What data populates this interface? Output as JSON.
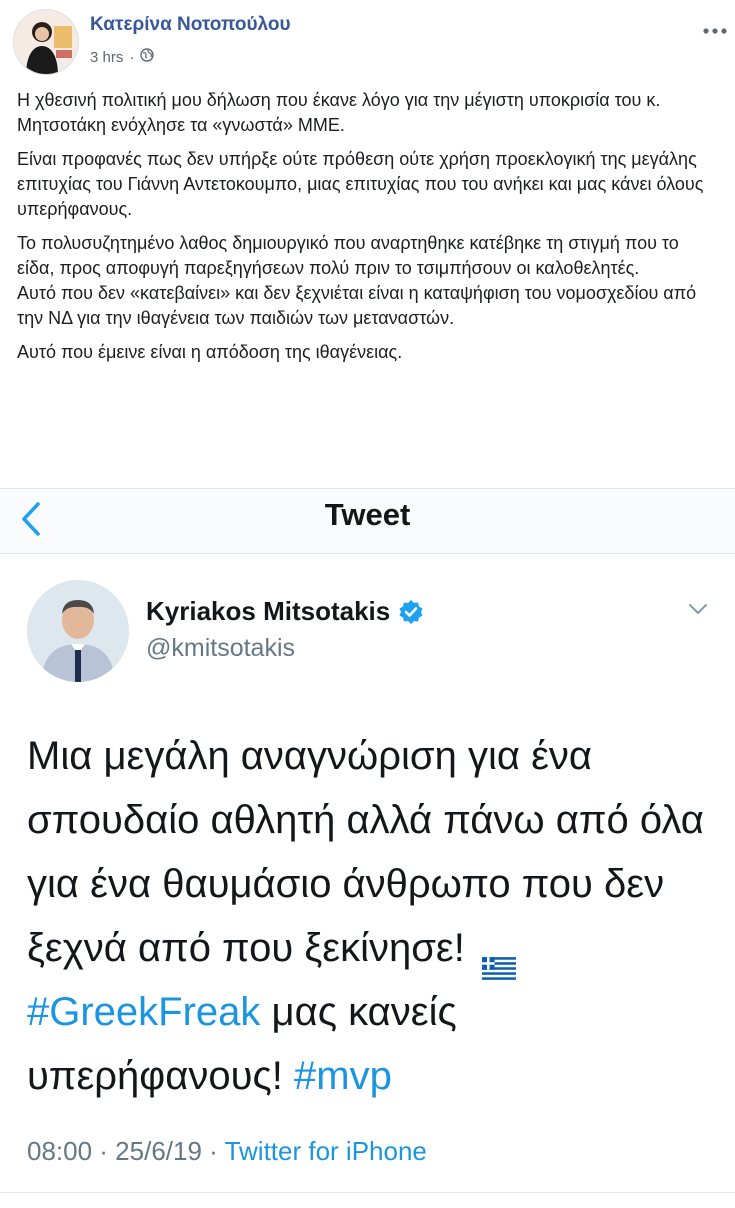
{
  "post": {
    "author": "Κατερίνα Νοτοπούλου",
    "time": "3 hrs",
    "privacy_icon": "globe-icon",
    "more_icon": "more-dots-icon",
    "paragraphs": [
      "Η χθεσινή πολιτική μου δήλωση που έκανε λόγο για την μέγιστη υποκρισία του κ. Μητσοτάκη ενόχλησε τα «γνωστά» ΜΜΕ.",
      "Είναι προφανές πως δεν υπήρξε ούτε πρόθεση ούτε χρήση προεκλογική της μεγάλης επιτυχίας του Γιάννη Αντετοκουμπο, μιας επιτυχίας που του ανήκει και μας κάνει όλους υπερήφανους.",
      "Το πολυσυζητημένο λαθος δημιουργικό που αναρτηθηκε κατέβηκε τη στιγμή που το είδα, προς αποφυγή παρεξηγήσεων πολύ πριν το τσιμπήσουν οι καλοθελητές.",
      "Αυτό που δεν «κατεβαίνει» και δεν ξεχνιέται είναι η καταψήφιση του νομοσχεδίου από την ΝΔ για την ιθαγένεια των παιδιών των μεταναστών.",
      "Αυτό που έμεινε είναι η απόδοση της ιθαγένειας."
    ]
  },
  "tweet": {
    "nav_title": "Tweet",
    "back_icon": "chevron-left-icon",
    "name": "Kyriakos Mitsotakis",
    "handle": "@kmitsotakis",
    "verified_icon": "verified-badge-icon",
    "menu_icon": "chevron-down-icon",
    "text_1": "Μια μεγάλη αναγνώριση για ένα σπουδαίο αθλητή αλλά πάνω από όλα για ένα θαυμάσιο άνθρωπο που δεν ξεχνά από που ξεκίνησε!",
    "flag_icon": "greek-flag-icon",
    "hashtag_1": "#GreekFreak",
    "text_2": " μας κανείς υπερήφανους! ",
    "hashtag_2": "#mvp",
    "time": "08:00 · 25/6/19 · ",
    "source": "Twitter for iPhone"
  },
  "colors": {
    "fb_link": "#385898",
    "twitter_blue": "#1da1f2",
    "hashtag": "#1b95e0",
    "muted": "#657786"
  }
}
